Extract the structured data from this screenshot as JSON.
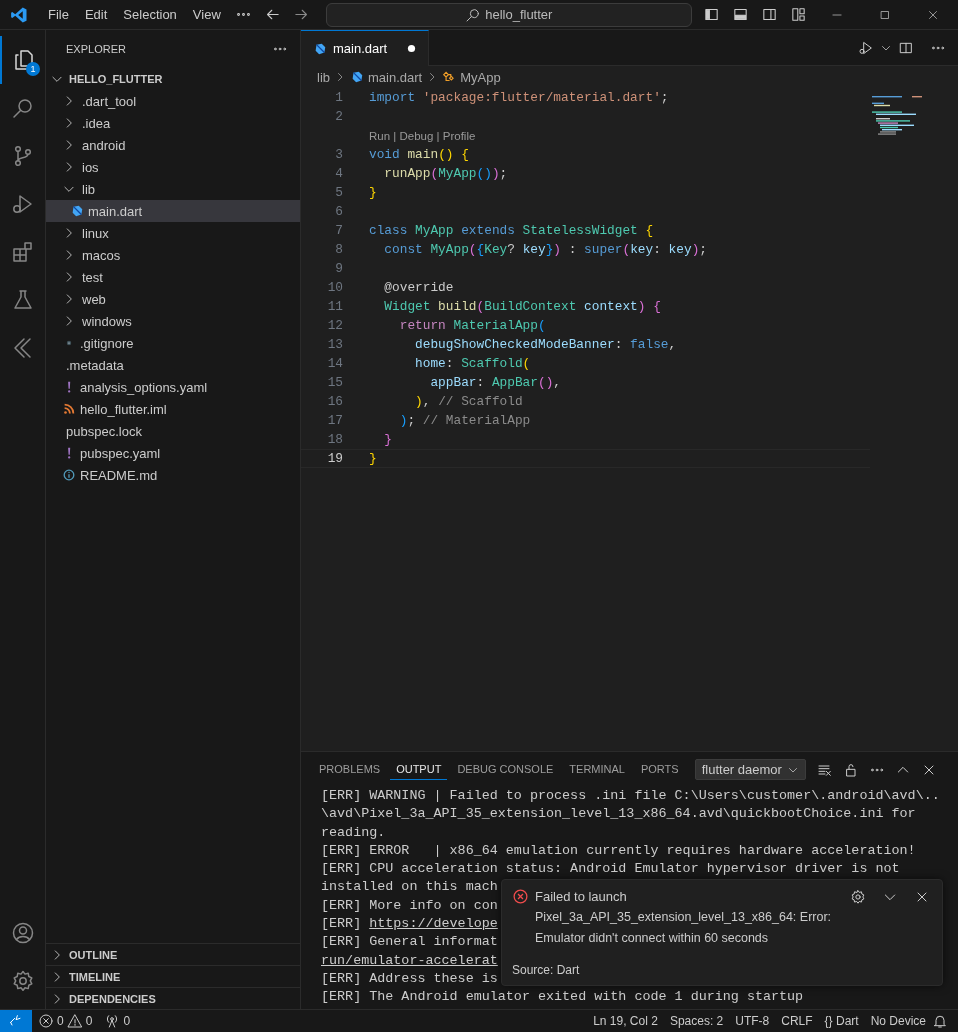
{
  "title_bar": {
    "menu": [
      "File",
      "Edit",
      "Selection",
      "View"
    ],
    "search": "hello_flutter"
  },
  "activity_bar": {
    "explorer_badge": "1"
  },
  "explorer": {
    "title": "EXPLORER",
    "root": {
      "label": "HELLO_FLUTTER",
      "expanded": true,
      "children": [
        {
          "label": ".dart_tool",
          "kind": "folder",
          "expanded": false,
          "selected": false
        },
        {
          "label": ".idea",
          "kind": "folder",
          "expanded": false,
          "selected": false
        },
        {
          "label": "android",
          "kind": "folder",
          "expanded": false,
          "selected": false
        },
        {
          "label": "ios",
          "kind": "folder",
          "expanded": false,
          "selected": false
        },
        {
          "label": "lib",
          "kind": "folder",
          "expanded": true,
          "selected": false,
          "children": [
            {
              "label": "main.dart",
              "kind": "dart",
              "selected": true
            }
          ]
        },
        {
          "label": "linux",
          "kind": "folder",
          "expanded": false,
          "selected": false
        },
        {
          "label": "macos",
          "kind": "folder",
          "expanded": false,
          "selected": false
        },
        {
          "label": "test",
          "kind": "folder",
          "expanded": false,
          "selected": false
        },
        {
          "label": "web",
          "kind": "folder",
          "expanded": false,
          "selected": false
        },
        {
          "label": "windows",
          "kind": "folder",
          "expanded": false,
          "selected": false
        },
        {
          "label": ".gitignore",
          "kind": "git",
          "selected": false
        },
        {
          "label": ".metadata",
          "kind": "plain",
          "selected": false
        },
        {
          "label": "analysis_options.yaml",
          "kind": "yaml",
          "selected": false
        },
        {
          "label": "hello_flutter.iml",
          "kind": "feed",
          "selected": false
        },
        {
          "label": "pubspec.lock",
          "kind": "plain",
          "selected": false
        },
        {
          "label": "pubspec.yaml",
          "kind": "yaml",
          "selected": false
        },
        {
          "label": "README.md",
          "kind": "info",
          "selected": false
        }
      ]
    },
    "sections": [
      {
        "label": "OUTLINE",
        "expanded": false
      },
      {
        "label": "TIMELINE",
        "expanded": false
      },
      {
        "label": "DEPENDENCIES",
        "expanded": false
      }
    ]
  },
  "editor": {
    "tabs": [
      {
        "label": "main.dart",
        "modified": true,
        "selected": true
      }
    ],
    "breadcrumb": [
      {
        "label": "lib",
        "kind": "folder"
      },
      {
        "label": "main.dart",
        "kind": "dart"
      },
      {
        "label": "MyApp",
        "kind": "class"
      }
    ],
    "lines": [
      {
        "kind": "code",
        "number": "1",
        "current": false,
        "tokens": [
          {
            "text": "import",
            "kind": "kw"
          },
          {
            "text": " 'package:flutter/material.dart'",
            "kind": "str"
          },
          {
            "text": ";",
            "kind": "plain"
          }
        ]
      },
      {
        "kind": "code",
        "number": "2",
        "current": false
      },
      {
        "kind": "codelens",
        "tokens": [
          {
            "text": "Run",
            "kind": "link"
          },
          {
            "text": " | ",
            "kind": "sep"
          },
          {
            "text": "Debug",
            "kind": "link"
          },
          {
            "text": " | ",
            "kind": "sep"
          },
          {
            "text": "Profile",
            "kind": "link"
          }
        ]
      },
      {
        "kind": "code",
        "number": "3",
        "current": false,
        "tokens": [
          {
            "text": "void",
            "kind": "kw"
          },
          {
            "text": " main",
            "kind": "fn"
          },
          {
            "text": "()",
            "kind": "b1"
          },
          {
            "text": " {",
            "kind": "b1"
          }
        ]
      },
      {
        "kind": "code",
        "number": "4",
        "current": false,
        "tokens": [
          {
            "text": "  runApp",
            "kind": "fn"
          },
          {
            "text": "(",
            "kind": "b2"
          },
          {
            "text": "MyApp",
            "kind": "type"
          },
          {
            "text": "()",
            "kind": "b3"
          },
          {
            "text": ")",
            "kind": "b2"
          },
          {
            "text": ";",
            "kind": "plain"
          }
        ]
      },
      {
        "kind": "code",
        "number": "5",
        "current": false,
        "tokens": [
          {
            "text": "}",
            "kind": "b1"
          }
        ]
      },
      {
        "kind": "code",
        "number": "6",
        "current": false
      },
      {
        "kind": "code",
        "number": "7",
        "current": false,
        "tokens": [
          {
            "text": "class",
            "kind": "kw"
          },
          {
            "text": " MyApp",
            "kind": "type"
          },
          {
            "text": " extends",
            "kind": "kw"
          },
          {
            "text": " StatelessWidget",
            "kind": "type"
          },
          {
            "text": " {",
            "kind": "b1"
          }
        ]
      },
      {
        "kind": "code",
        "number": "8",
        "current": false,
        "tokens": [
          {
            "text": "  const",
            "kind": "kw"
          },
          {
            "text": " MyApp",
            "kind": "type"
          },
          {
            "text": "(",
            "kind": "b2"
          },
          {
            "text": "{",
            "kind": "b3"
          },
          {
            "text": "Key",
            "kind": "type"
          },
          {
            "text": "? ",
            "kind": "plain"
          },
          {
            "text": "key",
            "kind": "var"
          },
          {
            "text": "}",
            "kind": "b3"
          },
          {
            "text": ")",
            "kind": "b2"
          },
          {
            "text": " : ",
            "kind": "plain"
          },
          {
            "text": "super",
            "kind": "kw"
          },
          {
            "text": "(",
            "kind": "b2"
          },
          {
            "text": "key",
            "kind": "var"
          },
          {
            "text": ": ",
            "kind": "plain"
          },
          {
            "text": "key",
            "kind": "var"
          },
          {
            "text": ")",
            "kind": "b2"
          },
          {
            "text": ";",
            "kind": "plain"
          }
        ]
      },
      {
        "kind": "code",
        "number": "9",
        "current": false
      },
      {
        "kind": "code",
        "number": "10",
        "current": false,
        "tokens": [
          {
            "text": "  @override",
            "kind": "plain"
          }
        ]
      },
      {
        "kind": "code",
        "number": "11",
        "current": false,
        "tokens": [
          {
            "text": "  Widget",
            "kind": "type"
          },
          {
            "text": " build",
            "kind": "fn"
          },
          {
            "text": "(",
            "kind": "b2"
          },
          {
            "text": "BuildContext",
            "kind": "type"
          },
          {
            "text": " context",
            "kind": "var"
          },
          {
            "text": ")",
            "kind": "b2"
          },
          {
            "text": " {",
            "kind": "b2"
          }
        ]
      },
      {
        "kind": "code",
        "number": "12",
        "current": false,
        "tokens": [
          {
            "text": "    return",
            "kind": "ctrl"
          },
          {
            "text": " MaterialApp",
            "kind": "type"
          },
          {
            "text": "(",
            "kind": "b3"
          }
        ]
      },
      {
        "kind": "code",
        "number": "13",
        "current": false,
        "tokens": [
          {
            "text": "      debugShowCheckedModeBanner",
            "kind": "var"
          },
          {
            "text": ": ",
            "kind": "plain"
          },
          {
            "text": "false",
            "kind": "kw"
          },
          {
            "text": ",",
            "kind": "plain"
          }
        ]
      },
      {
        "kind": "code",
        "number": "14",
        "current": false,
        "tokens": [
          {
            "text": "      home",
            "kind": "var"
          },
          {
            "text": ": ",
            "kind": "plain"
          },
          {
            "text": "Scaffold",
            "kind": "type"
          },
          {
            "text": "(",
            "kind": "b1"
          }
        ]
      },
      {
        "kind": "code",
        "number": "15",
        "current": false,
        "tokens": [
          {
            "text": "        appBar",
            "kind": "var"
          },
          {
            "text": ": ",
            "kind": "plain"
          },
          {
            "text": "AppBar",
            "kind": "type"
          },
          {
            "text": "()",
            "kind": "b2"
          },
          {
            "text": ",",
            "kind": "plain"
          }
        ]
      },
      {
        "kind": "code",
        "number": "16",
        "current": false,
        "tokens": [
          {
            "text": "      )",
            "kind": "b1"
          },
          {
            "text": ", ",
            "kind": "plain"
          },
          {
            "text": "// Scaffold",
            "kind": "label"
          }
        ]
      },
      {
        "kind": "code",
        "number": "17",
        "current": false,
        "tokens": [
          {
            "text": "    )",
            "kind": "b3"
          },
          {
            "text": "; ",
            "kind": "plain"
          },
          {
            "text": "// MaterialApp",
            "kind": "label"
          }
        ]
      },
      {
        "kind": "code",
        "number": "18",
        "current": false,
        "tokens": [
          {
            "text": "  }",
            "kind": "b2"
          }
        ]
      },
      {
        "kind": "code",
        "number": "19",
        "current": true,
        "tokens": [
          {
            "text": "}",
            "kind": "b1"
          }
        ]
      }
    ]
  },
  "panel": {
    "tabs": [
      {
        "label": "PROBLEMS",
        "selected": false
      },
      {
        "label": "OUTPUT",
        "selected": true
      },
      {
        "label": "DEBUG CONSOLE",
        "selected": false
      },
      {
        "label": "TERMINAL",
        "selected": false
      },
      {
        "label": "PORTS",
        "selected": false
      }
    ],
    "channel": "flutter daemor",
    "output": [
      {
        "text": "[ERR] WARNING | Failed to process .ini file C:\\Users\\customer\\.android\\avd\\.."
      },
      {
        "text": "\\avd\\Pixel_3a_API_35_extension_level_13_x86_64.avd\\quickbootChoice.ini for"
      },
      {
        "text": "reading."
      },
      {
        "text": "[ERR] ERROR   | x86_64 emulation currently requires hardware acceleration!"
      },
      {
        "text": "[ERR] CPU acceleration status: Android Emulator hypervisor driver is not"
      },
      {
        "text": "installed on this mach"
      },
      {
        "text": "[ERR] More info on con"
      },
      {
        "text": "[ERR] ",
        "link": "https://develope"
      },
      {
        "text": "[ERR] General informat"
      },
      {
        "link": "run/emulator-accelerat"
      },
      {
        "text": "[ERR] Address these is"
      },
      {
        "text": "[ERR] The Android emulator exited with code 1 during startup"
      }
    ]
  },
  "notification": {
    "title": "Failed to launch",
    "message": "Pixel_3a_API_35_extension_level_13_x86_64: Error: Emulator didn't connect within 60 seconds",
    "source": "Source: Dart"
  },
  "status_bar": {
    "errors": "0",
    "warnings": "0",
    "ports": "0",
    "items": [
      "Ln 19, Col 2",
      "Spaces: 2",
      "UTF-8",
      "CRLF",
      "{} Dart",
      "No Device"
    ]
  }
}
